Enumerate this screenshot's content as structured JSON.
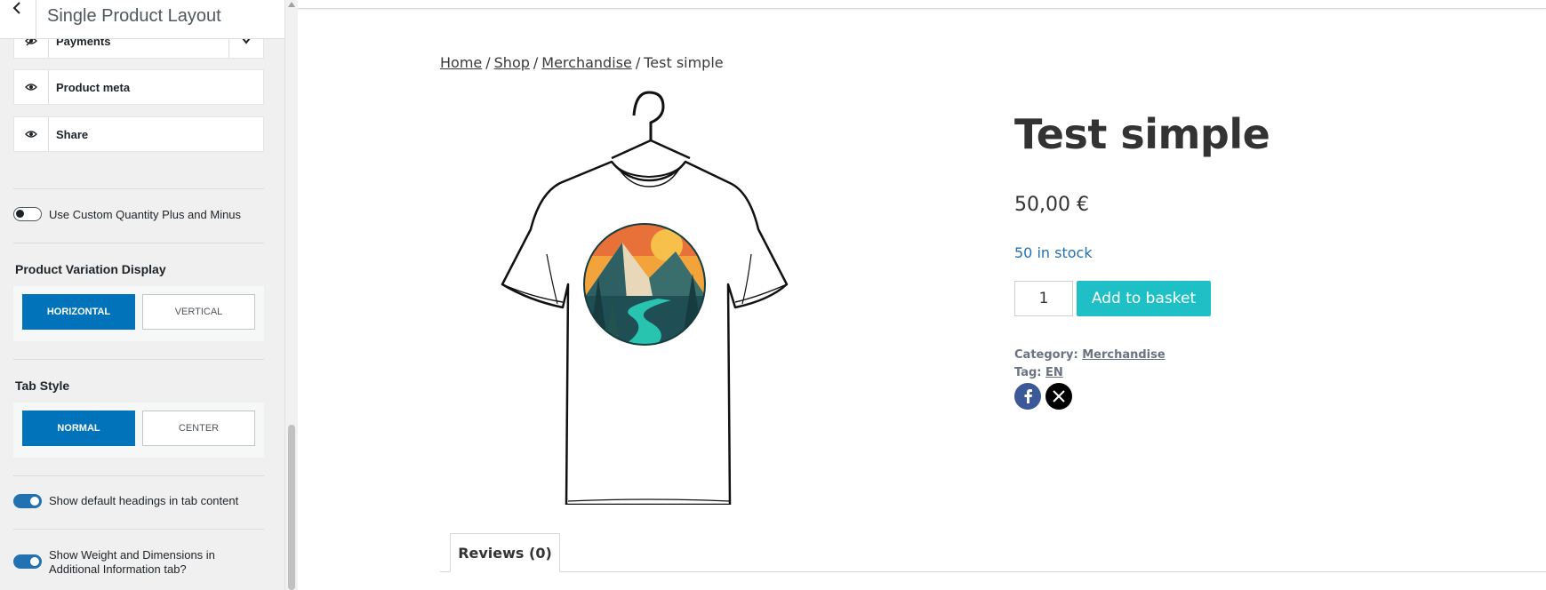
{
  "customizer": {
    "panel_title": "Single Product Layout",
    "elements": [
      {
        "label": "Payments",
        "icon": "eye-slash-icon"
      },
      {
        "label": "Product meta",
        "icon": "eye-icon"
      },
      {
        "label": "Share",
        "icon": "eye-icon"
      }
    ],
    "custom_quantity_toggle": {
      "label": "Use Custom Quantity Plus and Minus",
      "on": false
    },
    "variation_display": {
      "title": "Product Variation Display",
      "options": [
        "HORIZONTAL",
        "VERTICAL"
      ],
      "selected": "HORIZONTAL"
    },
    "tab_style": {
      "title": "Tab Style",
      "options": [
        "NORMAL",
        "CENTER"
      ],
      "selected": "NORMAL"
    },
    "default_headings_toggle": {
      "label": "Show default headings in tab content",
      "on": true
    },
    "weight_dimensions_toggle": {
      "label_line1": "Show Weight and Dimensions in",
      "label_line2": "Additional Information tab?",
      "on": true
    },
    "accent_color": "#0073ba"
  },
  "preview": {
    "breadcrumb": {
      "home": "Home",
      "shop": "Shop",
      "category": "Merchandise",
      "current": "Test simple",
      "separator": "/"
    },
    "product": {
      "title": "Test simple",
      "price": "50,00 €",
      "stock": "50 in stock",
      "quantity": "1",
      "add_to_basket": "Add to basket",
      "category_label": "Category:",
      "category_value": "Merchandise",
      "tag_label": "Tag:",
      "tag_value": "EN"
    },
    "share": [
      "facebook-icon",
      "x-icon"
    ],
    "tabs": [
      {
        "label": "Reviews (0)",
        "active": true
      }
    ],
    "button_color": "#1ec0c6",
    "stock_color": "#2271b1"
  }
}
